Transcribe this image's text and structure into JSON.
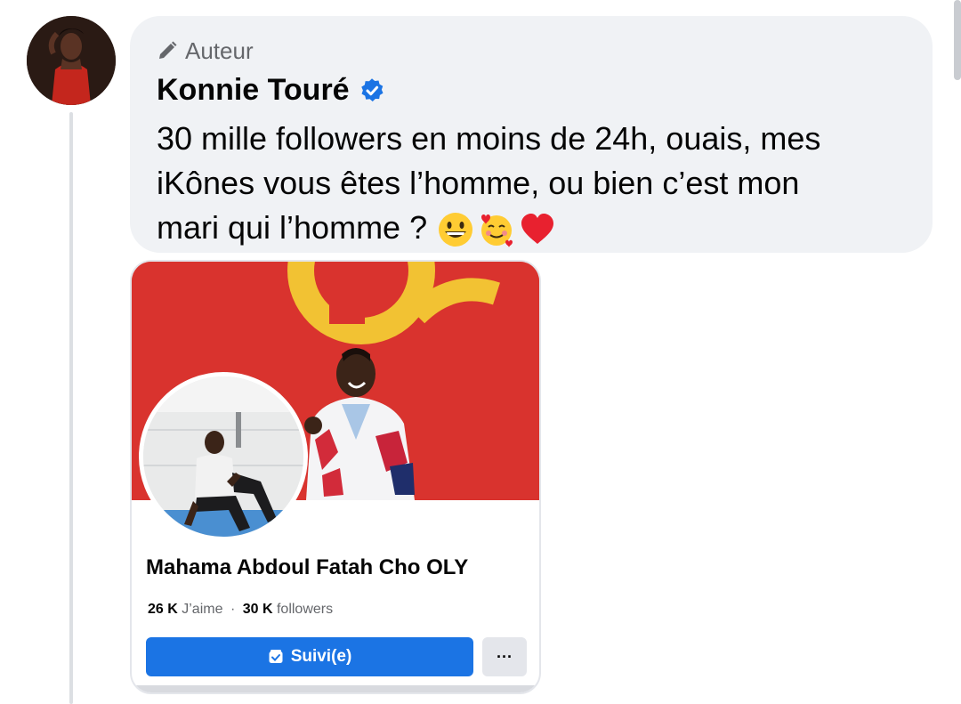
{
  "comment": {
    "author_tag": "Auteur",
    "author_name": "Konnie Touré",
    "text_line1": "30 mille followers en moins de 24h, ouais, mes",
    "text_line2": "iKônes vous êtes l’homme, ou bien c’est mon",
    "text_line3": "mari qui l’homme ?",
    "emojis": [
      "grinning-face-emoji",
      "smiling-face-with-hearts-emoji",
      "red-heart-emoji"
    ]
  },
  "page_card": {
    "name": "Mahama Abdoul Fatah Cho OLY",
    "likes_count": "26 K",
    "likes_label": "J’aime",
    "separator": "·",
    "followers_count": "30 K",
    "followers_label": "followers",
    "follow_button_label": "Suivi(e)",
    "more_button_label": "···"
  },
  "colors": {
    "accent": "#1b74e4",
    "bubble": "#f0f2f5",
    "cover_red": "#d9332e",
    "logo_yellow": "#f2c233"
  }
}
